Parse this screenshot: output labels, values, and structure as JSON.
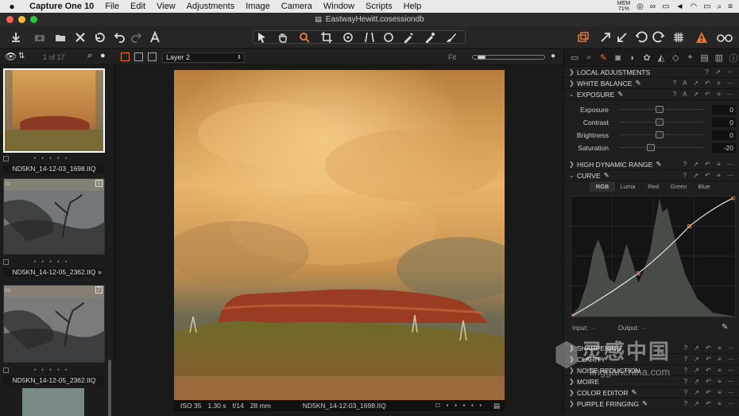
{
  "menubar": {
    "items": [
      "Capture One 10",
      "File",
      "Edit",
      "View",
      "Adjustments",
      "Image",
      "Camera",
      "Window",
      "Scripts",
      "Help"
    ],
    "mem_label": "MEM",
    "mem_value": "71%"
  },
  "window": {
    "title": "EastwayHewitt.cosessiondb"
  },
  "browser": {
    "counter": "1 of 17",
    "thumbnails": [
      {
        "name": "ND5KN_14-12-03_1698.IIQ",
        "badge": ""
      },
      {
        "name": "ND5KN_14-12-05_2362.IIQ",
        "badge": "1"
      },
      {
        "name": "ND5KN_14-12-05_2362.IIQ",
        "badge": "2"
      }
    ]
  },
  "viewer": {
    "layer": "Layer 2",
    "fit_label": "Fit",
    "info": {
      "iso": "ISO 35",
      "shutter": "1.30 s",
      "aperture": "f/14",
      "focal": "28 mm",
      "filename": "ND5KN_14-12-03_1698.IIQ"
    }
  },
  "panel": {
    "sections_top": [
      {
        "title": "LOCAL ADJUSTMENTS"
      },
      {
        "title": "WHITE BALANCE"
      },
      {
        "title": "EXPOSURE"
      }
    ],
    "exposure": [
      {
        "label": "Exposure",
        "value": "0",
        "level": 0.5
      },
      {
        "label": "Contrast",
        "value": "0",
        "level": 0.5
      },
      {
        "label": "Brightness",
        "value": "0",
        "level": 0.5
      },
      {
        "label": "Saturation",
        "value": "-20",
        "level": 0.4
      }
    ],
    "hdr": "HIGH DYNAMIC RANGE",
    "curve": {
      "title": "CURVE",
      "tabs": [
        "RGB",
        "Luma",
        "Red",
        "Green",
        "Blue"
      ],
      "input_label": "Input:",
      "input_value": "--",
      "output_label": "Output:",
      "output_value": "--"
    },
    "sections_bottom": [
      {
        "title": "SHARPENING"
      },
      {
        "title": "CLARITY"
      },
      {
        "title": "NOISE REDUCTION"
      },
      {
        "title": "MOIRE"
      },
      {
        "title": "COLOR EDITOR"
      },
      {
        "title": "PURPLE FRINGING"
      }
    ]
  },
  "watermark": {
    "text_cn": "灵感中国",
    "text_url": "lingganchina.com"
  },
  "colors": {
    "accent": "#e4783a",
    "warning": "#e8732e"
  }
}
